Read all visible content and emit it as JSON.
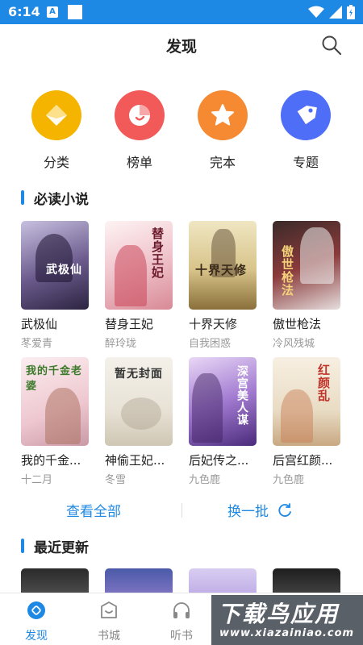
{
  "status": {
    "time": "6:14",
    "notif_letter": "A"
  },
  "header": {
    "title": "发现"
  },
  "categories": [
    {
      "label": "分类",
      "color": "#f5b400",
      "icon": "diamond-icon"
    },
    {
      "label": "榜单",
      "color": "#f25959",
      "icon": "chart-icon"
    },
    {
      "label": "完本",
      "color": "#f58a33",
      "icon": "star-icon"
    },
    {
      "label": "专题",
      "color": "#4f6ef7",
      "icon": "tag-icon"
    }
  ],
  "must_read": {
    "title": "必读小说",
    "books": [
      {
        "title": "武极仙",
        "author": "苳爱青",
        "cover_text": "武极仙",
        "cover_bg": "#6a5a8c"
      },
      {
        "title": "替身王妃",
        "author": "醉玲珑",
        "cover_text": "替身王妃",
        "cover_bg": "#d88a96"
      },
      {
        "title": "十界天修",
        "author": "自我困惑",
        "cover_text": "十界天修",
        "cover_bg": "#b9a46a"
      },
      {
        "title": "傲世枪法",
        "author": "冷风残城",
        "cover_text": "傲世枪法",
        "cover_bg": "#8a3a3a"
      },
      {
        "title": "我的千金...",
        "author": "十二月",
        "cover_text": "我的千金老婆",
        "cover_bg": "#e6cdd3"
      },
      {
        "title": "神偷王妃...",
        "author": "冬雪",
        "cover_text": "暂无封面",
        "cover_bg": "#e8e2d6"
      },
      {
        "title": "后妃传之...",
        "author": "九色鹿",
        "cover_text": "深宫美人谋",
        "cover_bg": "#7a5aa6"
      },
      {
        "title": "后宫红颜...",
        "author": "九色鹿",
        "cover_text": "红颜乱",
        "cover_bg": "#e9dcc4"
      }
    ]
  },
  "actions": {
    "view_all": "查看全部",
    "refresh": "换一批"
  },
  "recent": {
    "title": "最近更新",
    "covers": [
      "#3a3a3a",
      "#5a6aa8",
      "#c9b8e6",
      "#2a2a2a"
    ]
  },
  "bottom_nav": [
    {
      "label": "发现",
      "icon": "discover-icon",
      "active": true
    },
    {
      "label": "书城",
      "icon": "bookstore-icon",
      "active": false
    },
    {
      "label": "听书",
      "icon": "headphones-icon",
      "active": false
    }
  ],
  "watermark": {
    "main": "下载鸟应用",
    "sub": "www.xiazainiao.com"
  },
  "colors": {
    "accent": "#1e88e5",
    "muted": "#999999"
  }
}
